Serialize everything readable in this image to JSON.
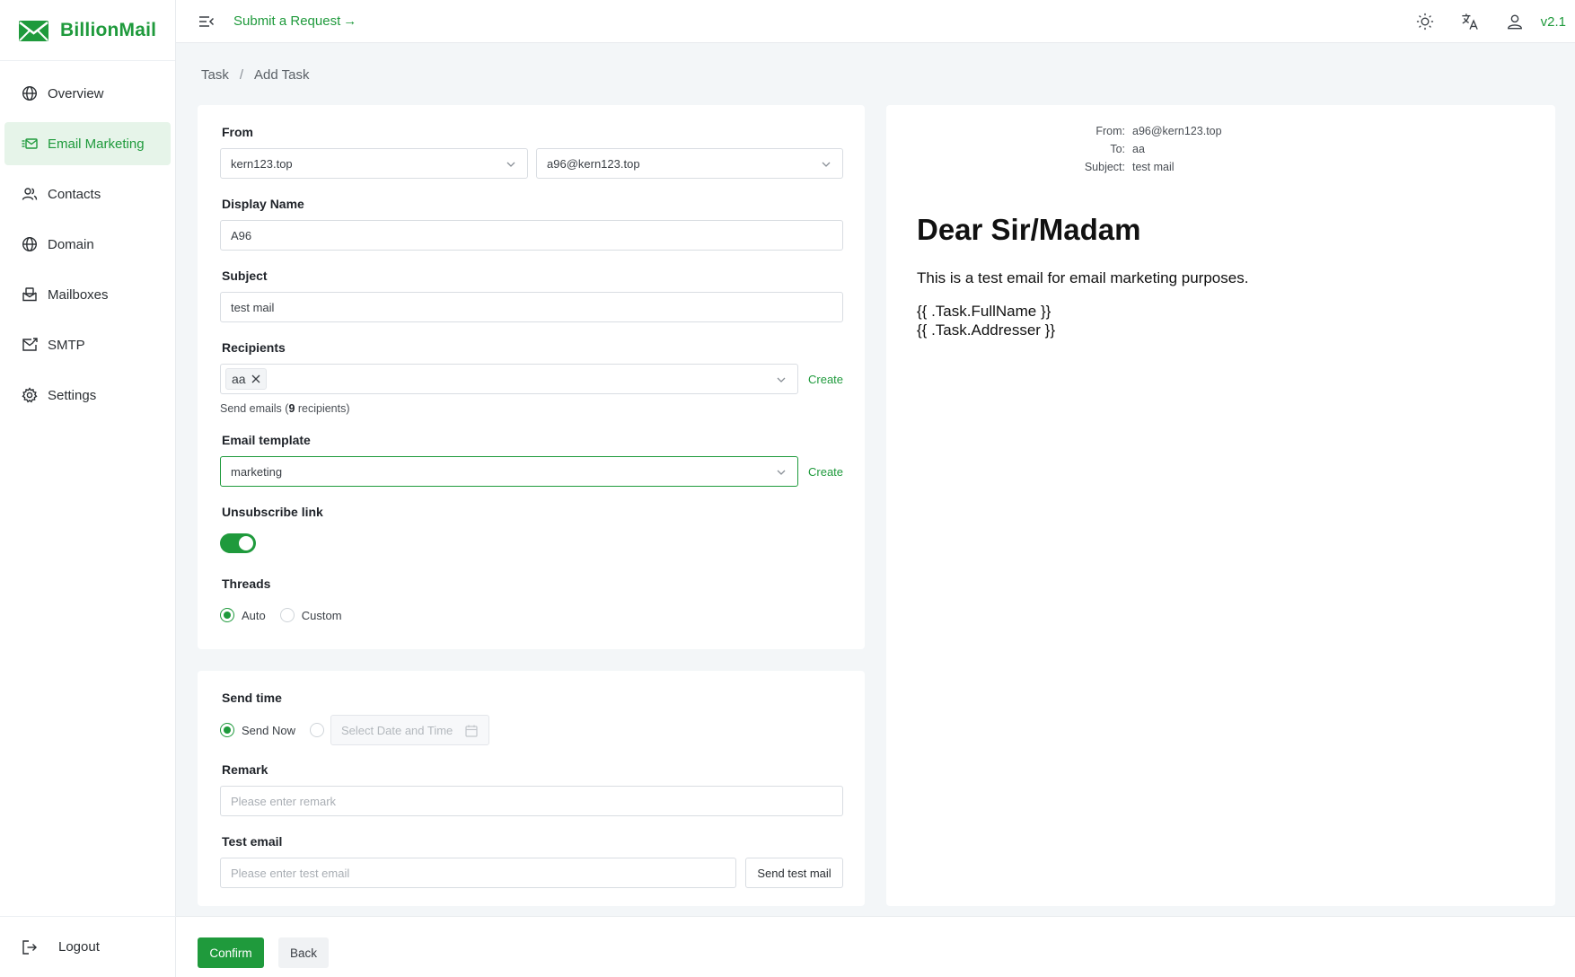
{
  "app": {
    "name": "BillionMail",
    "version": "v2.1",
    "accent": "#1f9a3c"
  },
  "sidebar": {
    "items": [
      {
        "label": "Overview",
        "icon": "globe-icon"
      },
      {
        "label": "Email Marketing",
        "icon": "email-marketing-icon"
      },
      {
        "label": "Contacts",
        "icon": "contacts-icon"
      },
      {
        "label": "Domain",
        "icon": "globe-icon"
      },
      {
        "label": "Mailboxes",
        "icon": "mailbox-icon"
      },
      {
        "label": "SMTP",
        "icon": "smtp-icon"
      },
      {
        "label": "Settings",
        "icon": "gear-icon"
      }
    ],
    "logout": "Logout"
  },
  "header": {
    "submit_request": "Submit a Request →"
  },
  "breadcrumb": {
    "parent": "Task",
    "separator": "/",
    "current": "Add Task"
  },
  "form": {
    "from_label": "From",
    "from_domain": "kern123.top",
    "from_address": "a96@kern123.top",
    "display_name_label": "Display Name",
    "display_name_value": "A96",
    "subject_label": "Subject",
    "subject_value": "test mail",
    "recipients_label": "Recipients",
    "recipient_tag": "aa",
    "recipients_create": "Create",
    "recipients_hint_prefix": "Send emails (",
    "recipients_count": "9",
    "recipients_hint_suffix": " recipients)",
    "template_label": "Email template",
    "template_value": "marketing",
    "template_create": "Create",
    "unsubscribe_label": "Unsubscribe link",
    "unsubscribe_on": true,
    "threads_label": "Threads",
    "threads_options": [
      "Auto",
      "Custom"
    ],
    "threads_selected": "Auto"
  },
  "send": {
    "send_time_label": "Send time",
    "send_now": "Send Now",
    "date_placeholder": "Select Date and Time",
    "remark_label": "Remark",
    "remark_placeholder": "Please enter remark",
    "test_email_label": "Test email",
    "test_email_placeholder": "Please enter test email",
    "send_test_button": "Send test mail"
  },
  "preview": {
    "from_key": "From:",
    "from_val": "a96@kern123.top",
    "to_key": "To:",
    "to_val": "aa",
    "subject_key": "Subject:",
    "subject_val": "test mail",
    "heading": "Dear Sir/Madam",
    "body": "This is a test email for email marketing purposes.",
    "var1": "{{ .Task.FullName }}",
    "var2": "{{ .Task.Addresser }}"
  },
  "footer": {
    "confirm": "Confirm",
    "back": "Back"
  }
}
